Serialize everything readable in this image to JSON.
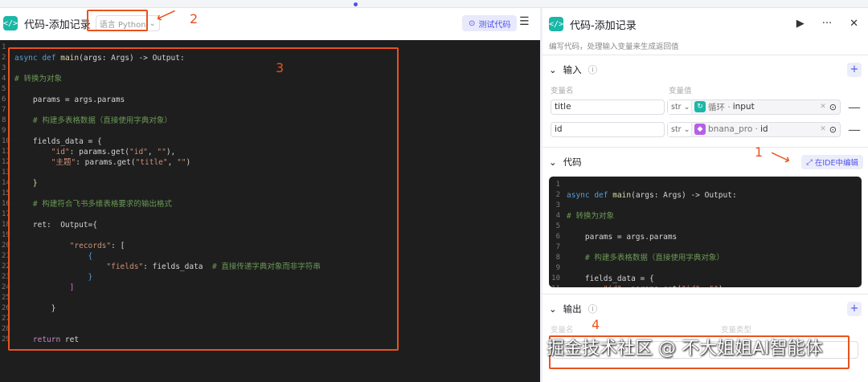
{
  "left": {
    "title": "代码-添加记录",
    "language": "语言 Python",
    "test_label": "测试代码"
  },
  "annotations": {
    "a1": "1",
    "a2": "2",
    "a3": "3",
    "a4": "4"
  },
  "code_lines": [
    [
      [
        "async ",
        "k"
      ],
      [
        "def ",
        "k"
      ],
      [
        "main",
        "f"
      ],
      [
        "(args: Args) -> Output:",
        "p"
      ]
    ],
    [],
    [
      [
        "# 转换为对象",
        "c"
      ]
    ],
    [],
    [
      [
        "    params = args.params",
        "p"
      ]
    ],
    [],
    [
      [
        "    # 构建多表格数据（直接使用字典对象）",
        "c"
      ]
    ],
    [],
    [
      [
        "    fields_data = {",
        "p"
      ]
    ],
    [
      [
        "        ",
        "p"
      ],
      [
        "\"id\"",
        "s"
      ],
      [
        ": params.get(",
        "p"
      ],
      [
        "\"id\"",
        "s"
      ],
      [
        ", ",
        "p"
      ],
      [
        "\"\"",
        "s"
      ],
      [
        "),",
        "p"
      ]
    ],
    [
      [
        "        ",
        "p"
      ],
      [
        "\"主题\"",
        "s"
      ],
      [
        ": params.get(",
        "p"
      ],
      [
        "\"title\"",
        "s"
      ],
      [
        ", ",
        "p"
      ],
      [
        "\"\"",
        "s"
      ],
      [
        ")",
        "p"
      ]
    ],
    [],
    [
      [
        "    }",
        "f"
      ]
    ],
    [],
    [
      [
        "    # 构建符合飞书多维表格要求的输出格式",
        "c"
      ]
    ],
    [],
    [
      [
        "    ret:  Output={",
        "p"
      ]
    ],
    [],
    [
      [
        "            ",
        "p"
      ],
      [
        "\"records\"",
        "s"
      ],
      [
        ": [",
        "p"
      ]
    ],
    [
      [
        "                {",
        "k"
      ]
    ],
    [
      [
        "                    ",
        "p"
      ],
      [
        "\"fields\"",
        "s"
      ],
      [
        ": fields_data  ",
        "p"
      ],
      [
        "# 直接传递字典对象而非字符串",
        "c"
      ]
    ],
    [
      [
        "                }",
        "k"
      ]
    ],
    [
      [
        "            ]",
        "b"
      ]
    ],
    [],
    [
      [
        "        }",
        "f"
      ]
    ],
    [],
    [],
    [
      [
        "    return ",
        "r"
      ],
      [
        "ret",
        "p"
      ]
    ]
  ],
  "right": {
    "title": "代码-添加记录",
    "subtitle": "编写代码，处理输入变量来生成返回值",
    "input_label": "输入",
    "col_name": "变量名",
    "col_value": "变量值",
    "inputs": [
      {
        "name": "title",
        "type": "str",
        "source": "循环 ·",
        "var": "input",
        "icon_color": "#1bb7a7"
      },
      {
        "name": "id",
        "type": "str",
        "source": "bnana_pro ·",
        "var": "id",
        "icon_color": "#b65ee8"
      }
    ],
    "code_label": "代码",
    "ide_label": "在IDE中编辑",
    "output_label": "输出",
    "out_col_name": "变量名",
    "out_col_type": "变量类型"
  },
  "watermark": "掘金技术社区 @ 不大姐姐AI智能体"
}
